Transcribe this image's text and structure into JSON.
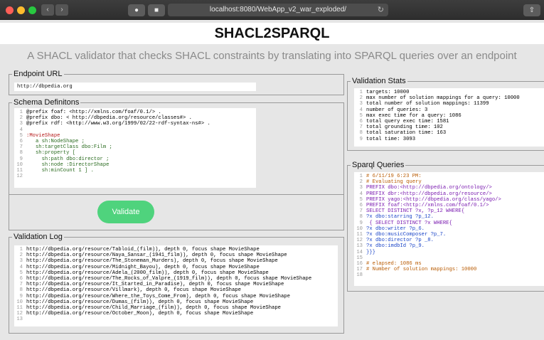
{
  "browser": {
    "url": "localhost:8080/WebApp_v2_war_exploded/"
  },
  "header": {
    "title": "SHACL2SPARQL",
    "subtitle": "A SHACL validator that checks SHACL constraints by translating into SPARQL queries over an endpoint"
  },
  "endpoint": {
    "legend": "Endpoint URL",
    "value": "http://dbpedia.org"
  },
  "schema": {
    "legend": "Schema Definitons",
    "lines": [
      "@prefix foaf: <http://xmlns.com/foaf/0.1/> .",
      "@prefix dbo: < http://dbpedia.org/resource/classes#> .",
      "@prefix rdf: <http://www.w3.org/1999/02/22-rdf-syntax-ns#> .",
      "",
      ":MovieShape",
      "   a sh:NodeShape ;",
      "   sh:targetClass dbo:Film ;",
      "   sh:property [",
      "     sh:path dbo:director ;",
      "     sh:node :DirectorShape",
      "     sh:minCount 1 ] .",
      ""
    ]
  },
  "validate_button": "Validate",
  "validation_log": {
    "legend": "Validation Log",
    "lines": [
      "http://dbpedia.org/resource/Tabloid_(film)), depth 0, focus shape MovieShape",
      "http://dbpedia.org/resource/Naya_Sansar_(1941_film)), depth 0, focus shape MovieShape",
      "http://dbpedia.org/resource/The_Stoneman_Murders), depth 0, focus shape MovieShape",
      "http://dbpedia.org/resource/Midnight_Bayou), depth 0, focus shape MovieShape",
      "http://dbpedia.org/resource/Adela_(2000_film)), depth 0, focus shape MovieShape",
      "http://dbpedia.org/resource/The_Rocks_of_Valpre_(1919_film)), depth 0, focus shape MovieShape",
      "http://dbpedia.org/resource/It_Started_in_Paradise), depth 0, focus shape MovieShape",
      "http://dbpedia.org/resource/Villmark), depth 0, focus shape MovieShape",
      "http://dbpedia.org/resource/Where_the_Toys_Come_From), depth 0, focus shape MovieShape",
      "http://dbpedia.org/resource/Dumas_(film)), depth 0, focus shape MovieShape",
      "http://dbpedia.org/resource/Child_Marriage_(film)), depth 0, focus shape MovieShape",
      "http://dbpedia.org/resource/October_Moon), depth 0, focus shape MovieShape",
      ""
    ]
  },
  "validation_stats": {
    "legend": "Validation Stats",
    "lines": [
      "targets: 10000",
      "max number of solution mappings for a query: 10000",
      "total number of solution mappings: 11399",
      "number of queries: 3",
      "max exec time for a query: 1086",
      "total query exec time: 1581",
      "total grounding time: 102",
      "total saturation time: 163",
      "total time: 3093"
    ]
  },
  "sparql_queries": {
    "legend": "Sparql Queries",
    "lines": [
      "# 6/11/19 6:23 PM:",
      "# Evaluating query",
      "PREFIX dbo:<http://dbpedia.org/ontology/>",
      "PREFIX dbr:<http://dbpedia.org/resource/>",
      "PREFIX yago:<http://dbpedia.org/class/yago/>",
      "PREFIX foaf:<http://xmlns.com/foaf/0.1/>",
      "SELECT DISTINCT ?x, ?p_12 WHERE{",
      "?x dbo:starring ?p_12.",
      " { SELECT DISTINCT ?x WHERE{",
      "?x dbo:writer ?p_6.",
      "?x dbo:musicComposer ?p_7.",
      "?x dbo:director ?p _8.",
      "?x dbo:imdbId ?p_9.",
      "}}}",
      "",
      "# elapsed: 1086 ms",
      "# Number of solution mappings: 10000",
      ""
    ]
  },
  "colors": {
    "validate_button": "#4fd37d",
    "keyword": "#7a1bb0",
    "iri": "#1a44c8",
    "comment": "#b85a00"
  }
}
